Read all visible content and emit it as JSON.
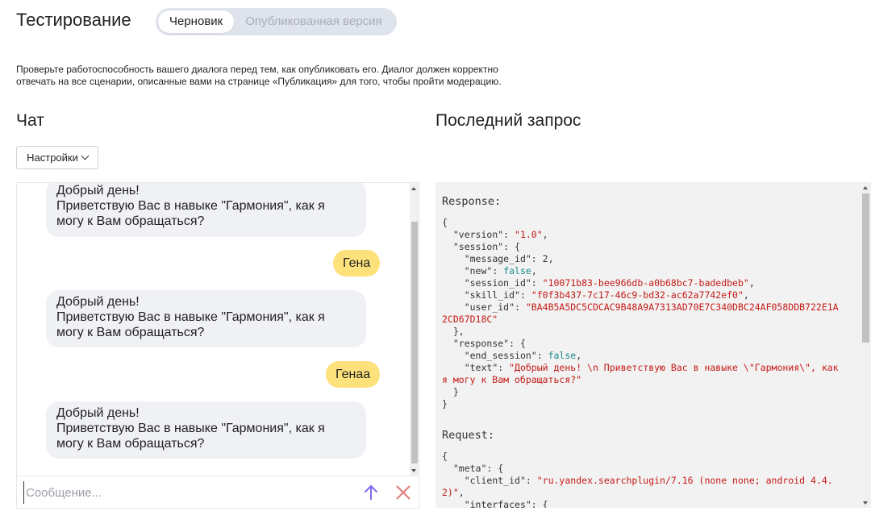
{
  "header": {
    "title": "Тестирование",
    "tabs": [
      {
        "label": "Черновик",
        "active": true
      },
      {
        "label": "Опубликованная версия",
        "active": false
      }
    ]
  },
  "intro": {
    "line1": "Проверьте работоспособность вашего диалога перед тем, как опубликовать его. Диалог должен корректно",
    "line2": "отвечать на все сценарии, описанные вами на странице «Публикация» для того, чтобы пройти модерацию."
  },
  "chat": {
    "title": "Чат",
    "settings_label": "Настройки",
    "messages": [
      {
        "from": "bot",
        "lines": [
          "Добрый день!",
          "Приветствую Вас в навыке \"Гармония\", как я",
          "могу к Вам обращаться?"
        ]
      },
      {
        "from": "user",
        "text": "Гена"
      },
      {
        "from": "bot",
        "lines": [
          "Добрый день!",
          "Приветствую Вас в навыке \"Гармония\", как я",
          "могу к Вам обращаться?"
        ]
      },
      {
        "from": "user",
        "text": "Генаа"
      },
      {
        "from": "bot",
        "lines": [
          "Добрый день!",
          "Приветствую Вас в навыке \"Гармония\", как я",
          "могу к Вам обращаться?"
        ]
      }
    ],
    "input_placeholder": "Сообщение...",
    "input_value": ""
  },
  "request_panel": {
    "title": "Последний запрос",
    "response_label": "Response:",
    "request_label": "Request:",
    "response": {
      "version": "\"1.0\"",
      "message_id": "2",
      "new": "false",
      "session_id": "\"10071b83-bee966db-a0b68bc7-badedbeb\"",
      "skill_id": "\"f0f3b437-7c17-46c9-bd32-ac62a7742ef0\"",
      "user_id_1": "\"BA4B5A5DC5CDCAC9B48A9A7313AD70E7C340DBC24AF058DDB722E1A",
      "user_id_2": "2CD67D18C\"",
      "end_session": "false",
      "text_1": "\"Добрый день! \\n Приветствую Вас в навыке \\\"Гармония\\\", как",
      "text_2": "я могу к Вам обращаться?\""
    },
    "request": {
      "client_id_1": "\"ru.yandex.searchplugin/7.16 (none none; android 4.4.",
      "client_id_2": "2)\""
    }
  },
  "colors": {
    "user_bubble": "#fde17a",
    "bot_bubble": "#eff1f4",
    "send_icon": "#7b68ee",
    "clear_icon": "#e07a7a",
    "json_string": "#c41a16",
    "json_bool": "#1a8a8a"
  },
  "icons": {
    "send": "arrow-up-icon",
    "clear": "close-icon",
    "dropdown": "chevron-down-icon"
  }
}
